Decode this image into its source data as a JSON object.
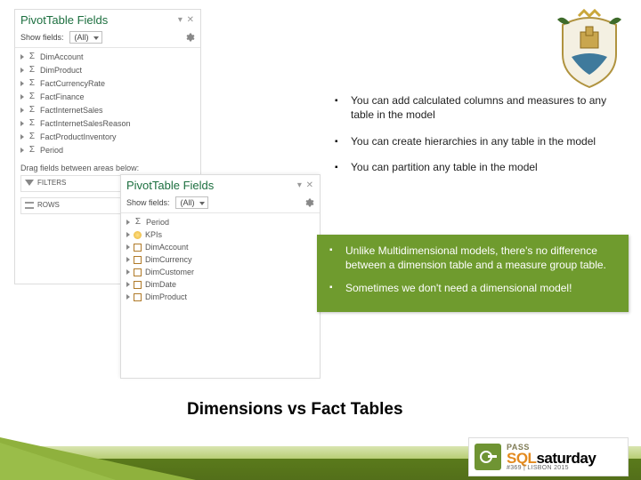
{
  "crest_alt": "City coat of arms",
  "pane": {
    "title": "PivotTable Fields",
    "show_label": "Show fields:",
    "show_value": "(All)"
  },
  "pane1_items": [
    {
      "sigma": true,
      "label": "DimAccount"
    },
    {
      "sigma": true,
      "label": "DimProduct"
    },
    {
      "sigma": true,
      "label": "FactCurrencyRate"
    },
    {
      "sigma": true,
      "label": "FactFinance"
    },
    {
      "sigma": true,
      "label": "FactInternetSales"
    },
    {
      "sigma": true,
      "label": "FactInternetSalesReason"
    },
    {
      "sigma": true,
      "label": "FactProductInventory"
    },
    {
      "sigma": true,
      "label": "Period"
    }
  ],
  "pane2_items": [
    {
      "icon": "sigma",
      "label": "Period"
    },
    {
      "icon": "kpi",
      "label": "KPIs"
    },
    {
      "icon": "cube",
      "label": "DimAccount"
    },
    {
      "icon": "cube",
      "label": "DimCurrency"
    },
    {
      "icon": "cube",
      "label": "DimCustomer"
    },
    {
      "icon": "cube",
      "label": "DimDate"
    },
    {
      "icon": "cube",
      "label": "DimProduct"
    }
  ],
  "drag_label": "Drag fields between areas below:",
  "zones": {
    "filters": "FILTERS",
    "rows": "ROWS"
  },
  "bullets": [
    "You can add calculated columns and measures to any table in the model",
    "You can create hierarchies in any table in the model",
    "You can partition any table in the model"
  ],
  "callout": [
    "Unlike Multidimensional models, there's no difference between a dimension table and a measure group table.",
    "Sometimes we don't need a dimensional model!"
  ],
  "slide_title": "Dimensions vs Fact Tables",
  "footer": {
    "pass": "PASS",
    "brand1": "SQL",
    "brand2": "saturday",
    "sub": "#369 | LISBON 2015"
  }
}
